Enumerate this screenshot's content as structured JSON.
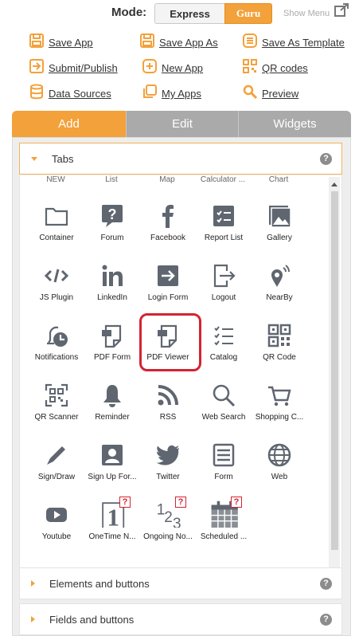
{
  "mode": {
    "label": "Mode:",
    "options": [
      "Express",
      "Guru"
    ],
    "active": "Guru",
    "show_menu": "Show Menu"
  },
  "links": [
    {
      "label": "Save App",
      "icon": "save-icon"
    },
    {
      "label": "Save App As",
      "icon": "save-as-icon"
    },
    {
      "label": "Save As Template",
      "icon": "template-icon"
    },
    {
      "label": "Submit/Publish",
      "icon": "submit-icon"
    },
    {
      "label": "New App",
      "icon": "new-app-icon"
    },
    {
      "label": "QR codes",
      "icon": "qr-code-icon"
    },
    {
      "label": "Data Sources",
      "icon": "database-icon"
    },
    {
      "label": "My Apps",
      "icon": "my-apps-icon"
    },
    {
      "label": "Preview",
      "icon": "magnifier-icon"
    }
  ],
  "tabs": [
    {
      "label": "Add",
      "active": true
    },
    {
      "label": "Edit",
      "active": false
    },
    {
      "label": "Widgets",
      "active": false
    }
  ],
  "accordions": [
    {
      "title": "Tabs",
      "open": true
    },
    {
      "title": "Elements and buttons",
      "open": false
    },
    {
      "title": "Fields and buttons",
      "open": false
    }
  ],
  "top_row": [
    "NEW",
    "List",
    "Map",
    "Calculator ...",
    "Chart"
  ],
  "widgets": [
    {
      "label": "Container",
      "icon": "folder-icon"
    },
    {
      "label": "Forum",
      "icon": "question-icon"
    },
    {
      "label": "Facebook",
      "icon": "facebook-icon"
    },
    {
      "label": "Report List",
      "icon": "report-list-icon"
    },
    {
      "label": "Gallery",
      "icon": "gallery-icon"
    },
    {
      "label": "JS Plugin",
      "icon": "code-icon"
    },
    {
      "label": "LinkedIn",
      "icon": "linkedin-icon"
    },
    {
      "label": "Login Form",
      "icon": "login-icon"
    },
    {
      "label": "Logout",
      "icon": "logout-icon"
    },
    {
      "label": "NearBy",
      "icon": "nearby-icon"
    },
    {
      "label": "Notifications",
      "icon": "notifications-icon"
    },
    {
      "label": "PDF Form",
      "icon": "pdf-form-icon"
    },
    {
      "label": "PDF Viewer",
      "icon": "pdf-viewer-icon"
    },
    {
      "label": "Catalog",
      "icon": "catalog-icon"
    },
    {
      "label": "QR Code",
      "icon": "qr-icon"
    },
    {
      "label": "QR Scanner",
      "icon": "qr-scanner-icon"
    },
    {
      "label": "Reminder",
      "icon": "bell-icon"
    },
    {
      "label": "RSS",
      "icon": "rss-icon"
    },
    {
      "label": "Web Search",
      "icon": "search-icon"
    },
    {
      "label": "Shopping C...",
      "icon": "cart-icon"
    },
    {
      "label": "Sign/Draw",
      "icon": "pencil-icon"
    },
    {
      "label": "Sign Up For...",
      "icon": "signup-icon"
    },
    {
      "label": "Twitter",
      "icon": "twitter-icon"
    },
    {
      "label": "Form",
      "icon": "form-icon"
    },
    {
      "label": "Web",
      "icon": "globe-icon"
    },
    {
      "label": "Youtube",
      "icon": "youtube-icon"
    },
    {
      "label": "OneTime N...",
      "icon": "onetime-icon"
    },
    {
      "label": "Ongoing No...",
      "icon": "ongoing-icon"
    },
    {
      "label": "Scheduled ...",
      "icon": "scheduled-icon"
    }
  ],
  "badge_text": "?",
  "help_text": "?",
  "colors": {
    "accent": "#f3a13a",
    "icon": "#5f6670",
    "highlight": "#d42332"
  }
}
